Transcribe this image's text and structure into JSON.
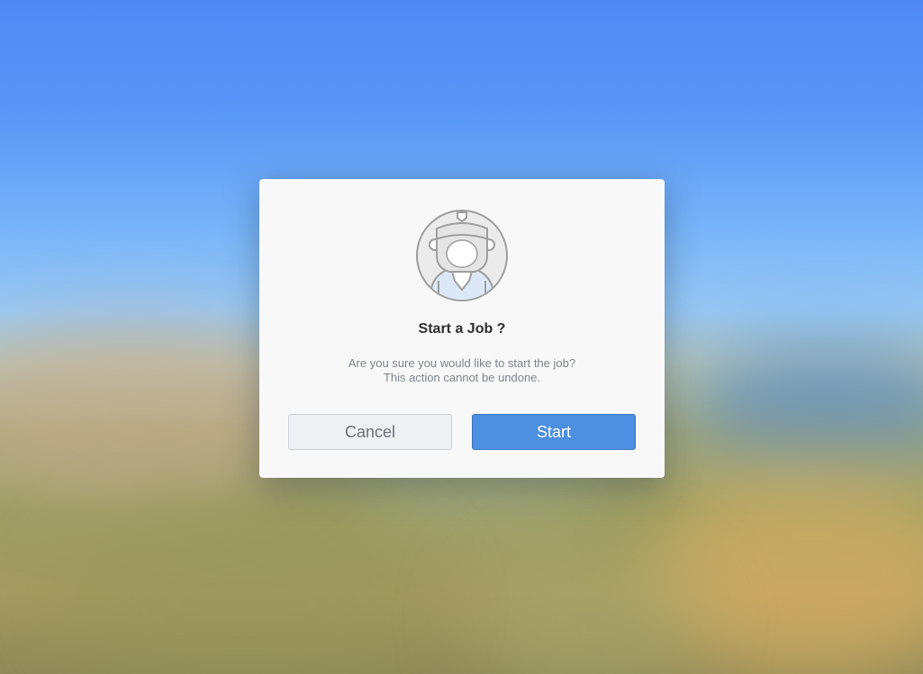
{
  "dialog": {
    "title": "Start a Job ?",
    "message_line1": "Are you sure you would like to start the job?",
    "message_line2": "This action cannot be undone.",
    "cancel_label": "Cancel",
    "start_label": "Start",
    "avatar_icon": "worker-avatar-icon"
  },
  "colors": {
    "primary": "#4d8fe0",
    "cancel_bg": "#eef1f4",
    "dialog_bg": "#f8f8f9"
  }
}
